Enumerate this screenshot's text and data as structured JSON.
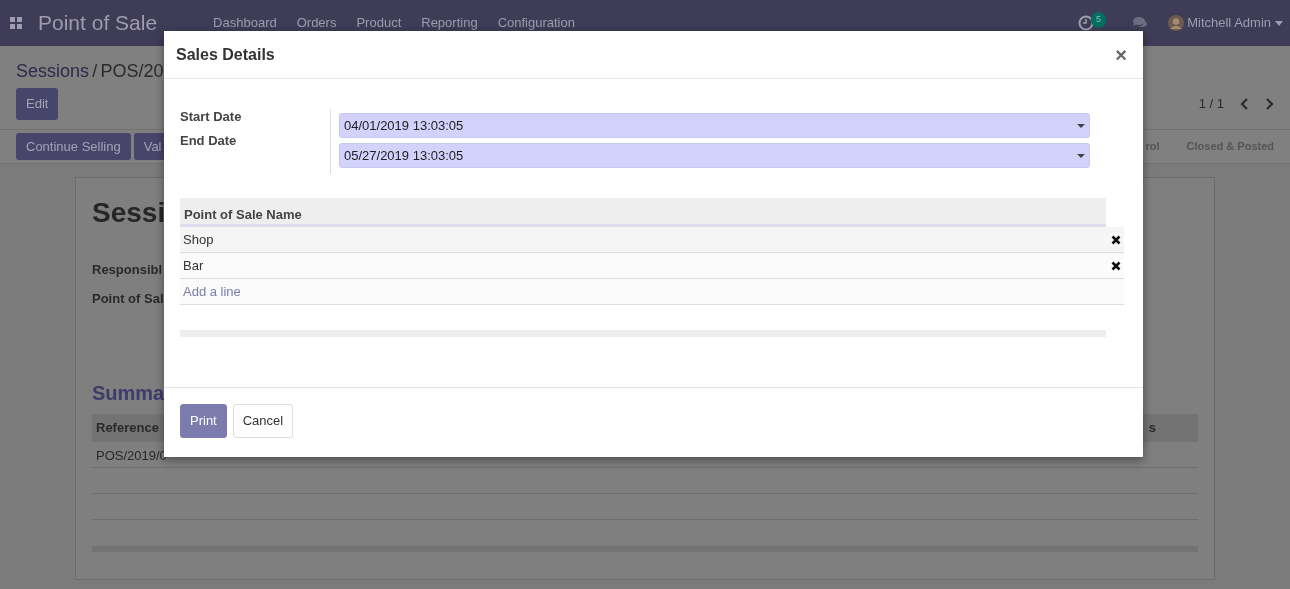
{
  "navbar": {
    "title": "Point of Sale",
    "menu": [
      "Dashboard",
      "Orders",
      "Product",
      "Reporting",
      "Configuration"
    ],
    "activity_count": "5",
    "user": "Mitchell Admin"
  },
  "breadcrumb": {
    "parent": "Sessions",
    "separator": "/",
    "current": "POS/20"
  },
  "control_panel": {
    "buttons": [
      "Edit"
    ],
    "pager": "1 / 1"
  },
  "status_bar": {
    "buttons": [
      "Continue Selling",
      "Val"
    ],
    "stages": [
      "rol",
      "Closed & Posted"
    ]
  },
  "form": {
    "title": "Sessi",
    "fields": [
      "Responsibl",
      "Point of Sal"
    ],
    "section": "Summa",
    "columns": [
      "Reference",
      "s"
    ],
    "rows": [
      "POS/2019/0"
    ]
  },
  "dialog": {
    "title": "Sales Details",
    "close": "×",
    "fields": [
      {
        "label": "Start Date",
        "value": "04/01/2019 13:03:05"
      },
      {
        "label": "End Date",
        "value": "05/27/2019 13:03:05"
      }
    ],
    "table": {
      "columns": [
        "Point of Sale Name"
      ],
      "rows": [
        "Shop",
        "Bar"
      ],
      "add_line": "Add a line"
    },
    "buttons": [
      {
        "label": "Print",
        "kind": "primary"
      },
      {
        "label": "Cancel",
        "kind": "secondary"
      }
    ]
  }
}
